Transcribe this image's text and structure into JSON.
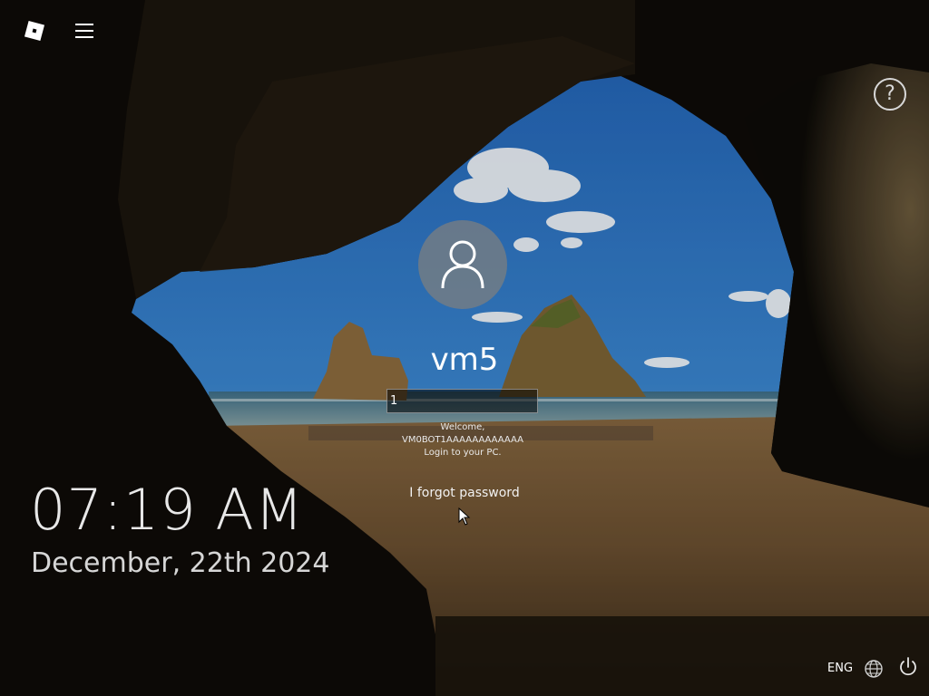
{
  "lock_screen": {
    "username": "vm5",
    "password_value": "1",
    "welcome_lines": [
      "Welcome,",
      "VM0BOT1AAAAAAAAAAAA",
      "Login to your PC."
    ],
    "forgot_password_label": "I forgot password",
    "time": "07:19 AM",
    "date": "December, 22th 2024"
  },
  "taskbar": {
    "language": "ENG"
  },
  "icons": {
    "logo": "roblox-logo-icon",
    "menu": "hamburger-menu-icon",
    "help": "help-icon",
    "avatar": "user-icon",
    "network": "globe-icon",
    "power": "power-icon"
  },
  "help_glyph": "?"
}
